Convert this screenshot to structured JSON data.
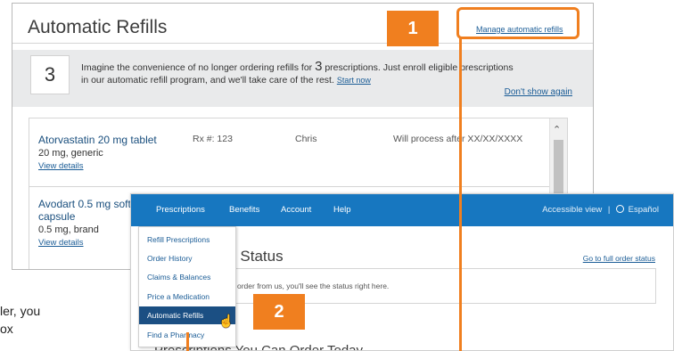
{
  "refills": {
    "title": "Automatic Refills",
    "manage_link": "Manage automatic refills",
    "promo": {
      "count": "3",
      "text_before": "Imagine the convenience of no longer ordering refills for ",
      "text_count": "3",
      "text_after": " prescriptions. Just enroll eligible prescriptions in our automatic refill program, and we'll take care of the rest. ",
      "start_link": "Start now",
      "dont_show": "Don't show again"
    },
    "items": [
      {
        "name": "Atorvastatin 20 mg tablet",
        "dose": "20 mg, generic",
        "link": "View details",
        "rx": "Rx #: 123",
        "person": "Chris",
        "status": "Will process after XX/XX/XXXX"
      },
      {
        "name": "Avodart 0.5 mg soft",
        "name_line2": "capsule",
        "dose": "0.5 mg, brand",
        "link": "View details"
      }
    ]
  },
  "behind_text": {
    "line1": "ler, you",
    "line2": "ox"
  },
  "nav": {
    "items": [
      "Prescriptions",
      "Benefits",
      "Account",
      "Help"
    ],
    "accessible": "Accessible view",
    "separator": "|",
    "language": "Español",
    "dropdown": [
      "Refill Prescriptions",
      "Order History",
      "Claims & Balances",
      "Price a Medication",
      "Automatic Refills",
      "Find a Pharmacy"
    ],
    "active_index": 4
  },
  "order": {
    "title": "r Status",
    "full_link": "Go to full order status",
    "text": "order from us, you'll see the status right here.",
    "section_title": "Prescriptions You Can Order Today"
  },
  "callouts": {
    "one": "1",
    "two": "2"
  },
  "colors": {
    "nav_blue": "#1777c0",
    "dropdown_active": "#1b4f83",
    "callout_orange": "#f07f1f",
    "link_blue": "#1a5c96"
  },
  "icons": {
    "scroll_up": "chevron-up-icon",
    "globe": "globe-icon",
    "cursor": "hand-pointer-icon"
  }
}
